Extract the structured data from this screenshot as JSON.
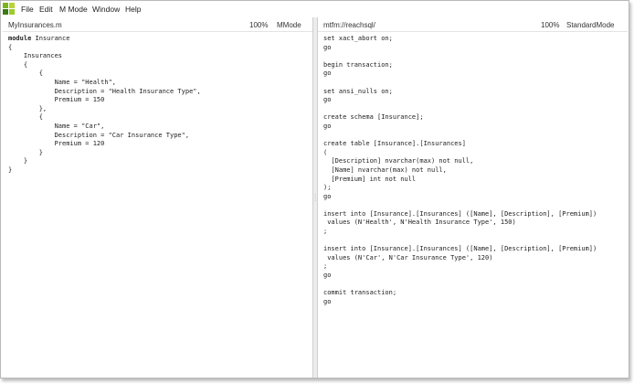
{
  "menu": {
    "items": [
      {
        "label": "File"
      },
      {
        "label": "Edit"
      },
      {
        "label": "M Mode"
      },
      {
        "label": "Window"
      },
      {
        "label": "Help"
      }
    ]
  },
  "colors": {
    "logo": [
      "#7cb518",
      "#b8d433",
      "#3d7a12",
      "#9ccc2a"
    ]
  },
  "left_pane": {
    "title": "MyInsurances.m",
    "zoom": "100%",
    "mode": "MMode",
    "code_lines": [
      "module Insurance",
      "{",
      "    Insurances",
      "    {",
      "        {",
      "            Name = \"Health\",",
      "            Description = \"Health Insurance Type\",",
      "            Premium = 150",
      "        },",
      "        {",
      "            Name = \"Car\",",
      "            Description = \"Car Insurance Type\",",
      "            Premium = 120",
      "        }",
      "    }",
      "}"
    ]
  },
  "right_pane": {
    "title": "mtfm://reachsql/",
    "zoom": "100%",
    "mode": "StandardMode",
    "code_lines": [
      "set xact_abort on;",
      "go",
      "",
      "begin transaction;",
      "go",
      "",
      "set ansi_nulls on;",
      "go",
      "",
      "create schema [Insurance];",
      "go",
      "",
      "create table [Insurance].[Insurances]",
      "(",
      "  [Description] nvarchar(max) not null,",
      "  [Name] nvarchar(max) not null,",
      "  [Premium] int not null",
      ");",
      "go",
      "",
      "insert into [Insurance].[Insurances] ([Name], [Description], [Premium])",
      " values (N'Health', N'Health Insurance Type', 150)",
      ";",
      "",
      "insert into [Insurance].[Insurances] ([Name], [Description], [Premium])",
      " values (N'Car', N'Car Insurance Type', 120)",
      ";",
      "go",
      "",
      "commit transaction;",
      "go"
    ]
  }
}
